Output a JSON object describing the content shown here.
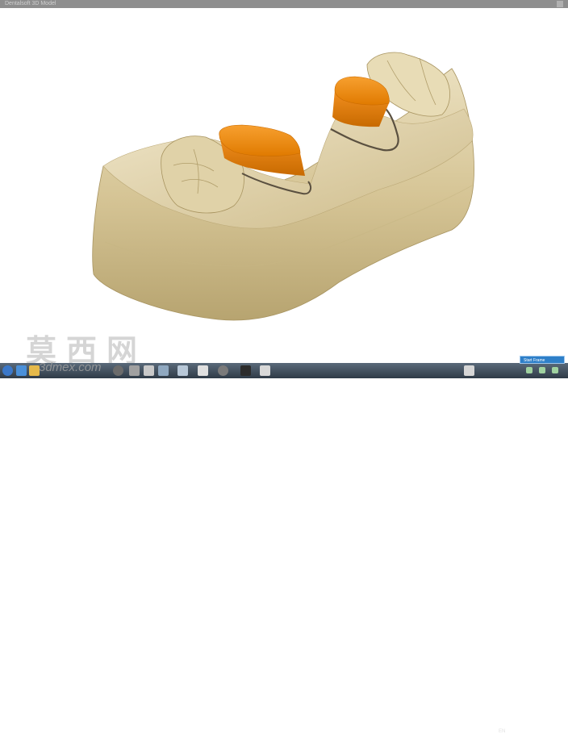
{
  "window": {
    "title": "Dentalsoft 3D Model"
  },
  "watermark": {
    "text": "莫西网",
    "site": "3dmex.com"
  },
  "notification": {
    "label": "Start Frame"
  },
  "tray": {
    "lang": "EN"
  },
  "colors": {
    "stone": "#d8c9a0",
    "abutment": "#f08a10",
    "background": "#ffffff",
    "taskbar": "#3b4855"
  },
  "taskbar_icons": [
    "start-icon",
    "ie-icon",
    "folder-icon",
    "media-icon",
    "app-icon-1",
    "app-icon-2",
    "app-icon-3",
    "app-icon-4",
    "app-icon-5",
    "app-icon-6",
    "app-icon-7",
    "app-icon-8",
    "app-icon-9",
    "app-icon-10",
    "app-icon-11",
    "app-icon-12"
  ]
}
